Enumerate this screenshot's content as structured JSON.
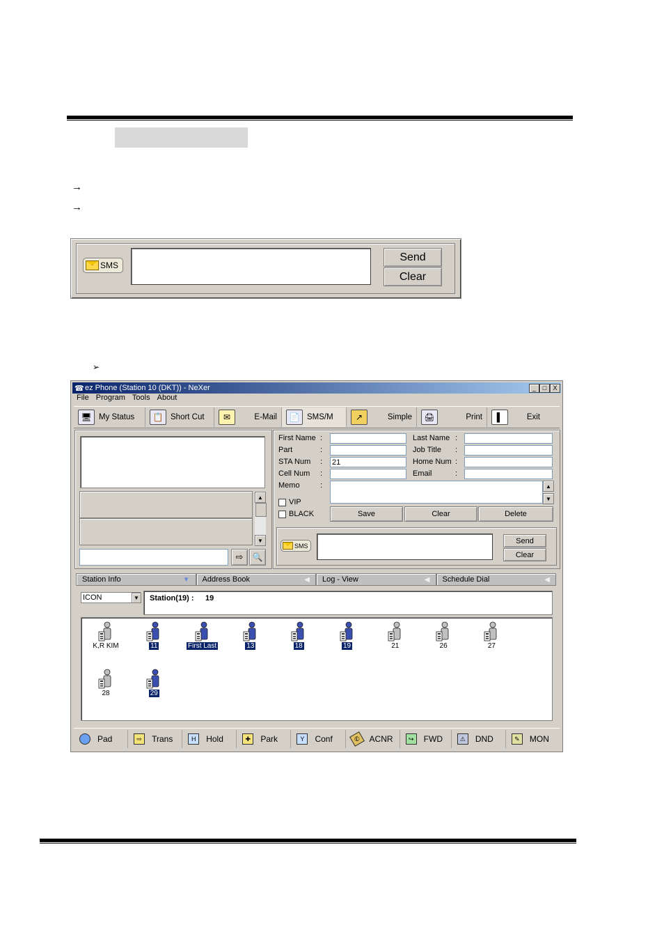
{
  "sms_panel": {
    "badge_label": "SMS",
    "send_label": "Send",
    "clear_label": "Clear"
  },
  "window": {
    "title": "ez Phone (Station 10 (DKT)) - NeXer",
    "controls": [
      "_",
      "□",
      "X"
    ],
    "menu": [
      "File",
      "Program",
      "Tools",
      "About"
    ],
    "toolbar": [
      {
        "label": "My Status",
        "icon": "monitor-icon"
      },
      {
        "label": "Short Cut",
        "icon": "clipboard-icon"
      },
      {
        "label": "E-Mail",
        "icon": "mail-icon"
      },
      {
        "label": "SMS/M",
        "icon": "document-phone-icon"
      },
      {
        "label": "Simple",
        "icon": "simple-icon"
      },
      {
        "label": "Print",
        "icon": "printer-icon"
      },
      {
        "label": "Exit",
        "icon": "exit-icon"
      }
    ],
    "form": {
      "first_name_label": "First Name",
      "last_name_label": "Last Name",
      "part_label": "Part",
      "job_title_label": "Job Title",
      "sta_num_label": "STA Num",
      "sta_num_value": "21",
      "home_num_label": "Home Num",
      "cell_num_label": "Cell Num",
      "email_label": "Email",
      "memo_label": "Memo",
      "colon": ":",
      "vip_label": "VIP",
      "black_label": "BLACK",
      "save_label": "Save",
      "clear_label": "Clear",
      "delete_label": "Delete"
    },
    "sms": {
      "badge_label": "SMS",
      "send_label": "Send",
      "clear_label": "Clear"
    },
    "tabs": [
      "Station Info",
      "Address Book",
      "Log - View",
      "Schedule Dial"
    ],
    "view_select": "ICON",
    "station_header": "Station(19) :",
    "station_header_value": "19",
    "stations": [
      {
        "label": "K,R KIM",
        "selected": false,
        "color": "#c0c0c0"
      },
      {
        "label": "11",
        "selected": true,
        "color": "#3a4fb0"
      },
      {
        "label": "First Last",
        "selected": true,
        "color": "#3a4fb0"
      },
      {
        "label": "13",
        "selected": true,
        "color": "#3a4fb0"
      },
      {
        "label": "18",
        "selected": true,
        "color": "#3a4fb0"
      },
      {
        "label": "19",
        "selected": true,
        "color": "#3a4fb0"
      },
      {
        "label": "21",
        "selected": false,
        "color": "#c0c0c0"
      },
      {
        "label": "26",
        "selected": false,
        "color": "#c0c0c0"
      },
      {
        "label": "27",
        "selected": false,
        "color": "#c0c0c0"
      },
      {
        "label": "28",
        "selected": false,
        "color": "#c0c0c0"
      },
      {
        "label": "29",
        "selected": true,
        "color": "#3a4fb0"
      }
    ],
    "bottom": [
      "Pad",
      "Trans",
      "Hold",
      "Park",
      "Conf",
      "ACNR",
      "FWD",
      "DND",
      "MON"
    ]
  }
}
